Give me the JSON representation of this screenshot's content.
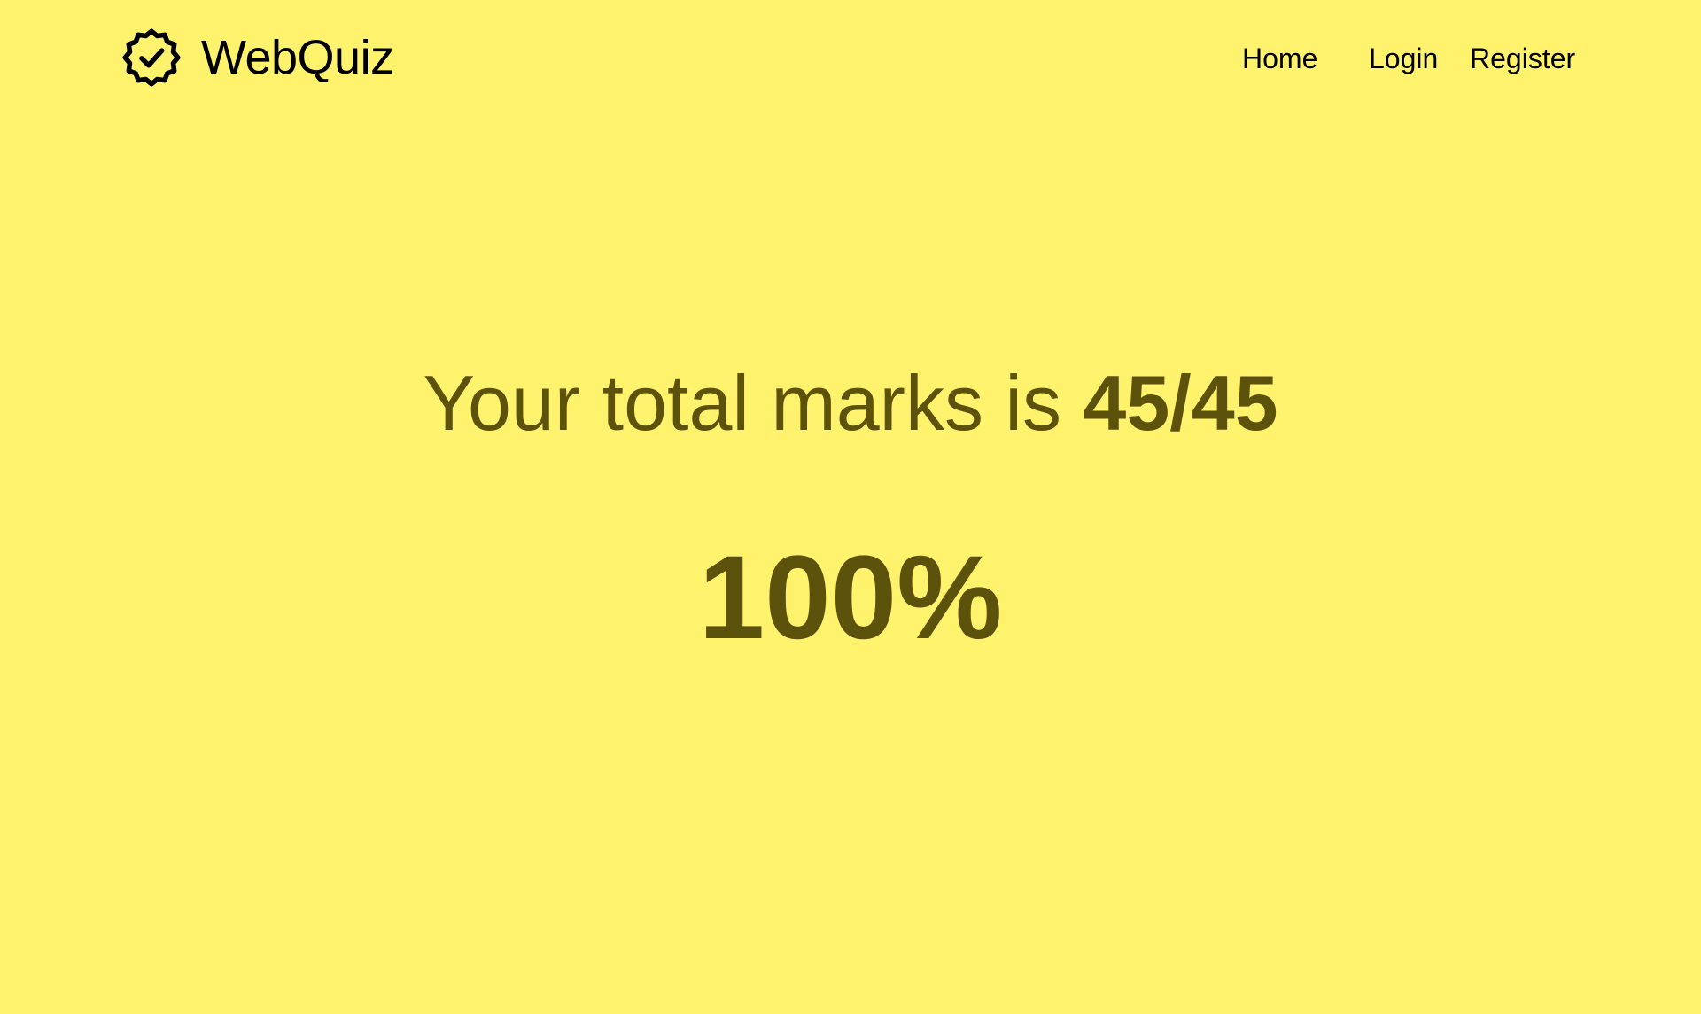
{
  "nav": {
    "brand": "WebQuiz",
    "brand_icon": "badge-check-icon",
    "links": [
      {
        "label": "Home"
      },
      {
        "label": "Login"
      },
      {
        "label": "Register"
      }
    ]
  },
  "result": {
    "text": "Your total marks is",
    "score": "45/45",
    "percentage": "100%"
  },
  "colors": {
    "background": "#fff36d",
    "result_text": "#5c520c",
    "nav_text": "#000000"
  }
}
